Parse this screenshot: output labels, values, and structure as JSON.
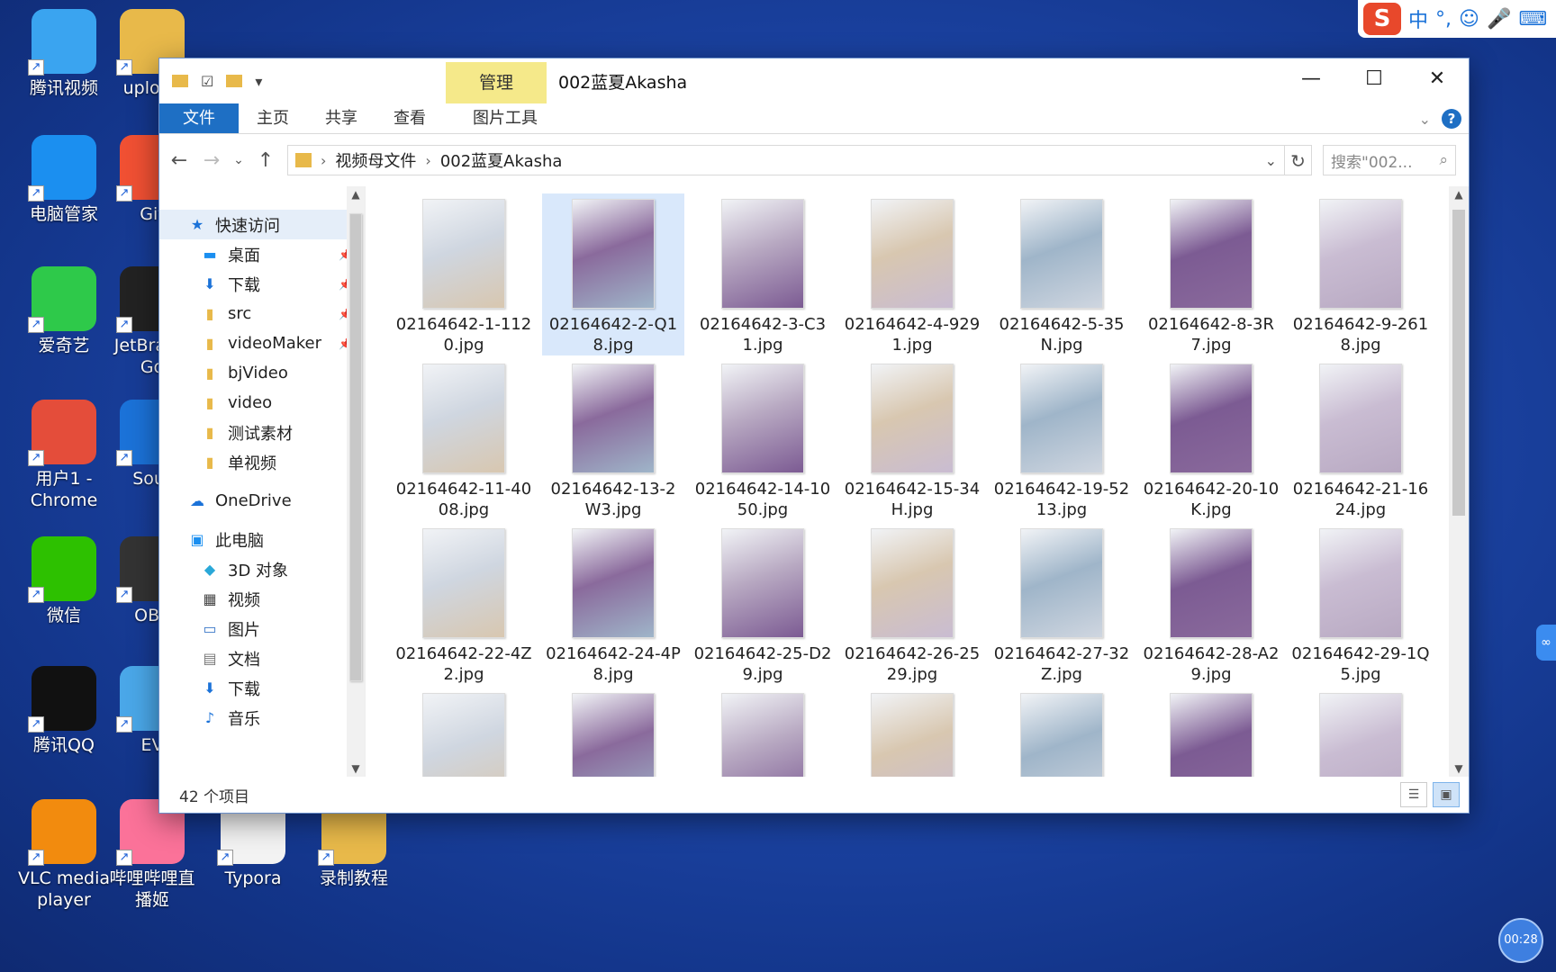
{
  "desktop_icons": [
    {
      "label": "腾讯视频",
      "color": "#3aa4f0"
    },
    {
      "label": "upload",
      "color": "#e8b94a"
    },
    {
      "label": "电脑管家",
      "color": "#1b8ff0"
    },
    {
      "label": "Git",
      "color": "#f05033"
    },
    {
      "label": "爱奇艺",
      "color": "#2ec94a"
    },
    {
      "label": "JetBrains Go",
      "color": "#222222"
    },
    {
      "label": "用户1 - Chrome",
      "color": "#e44d3a"
    },
    {
      "label": "Sour",
      "color": "#1b72d8"
    },
    {
      "label": "微信",
      "color": "#2dc100"
    },
    {
      "label": "OBS",
      "color": "#333333"
    },
    {
      "label": "腾讯QQ",
      "color": "#111111"
    },
    {
      "label": "EV",
      "color": "#4aa7e8"
    },
    {
      "label": "VLC media player",
      "color": "#f28b0e"
    },
    {
      "label": "哔哩哔哩直播姬",
      "color": "#fb7299"
    },
    {
      "label": "Typora",
      "color": "#f3f3f3"
    },
    {
      "label": "录制教程",
      "color": "#e8b94a"
    }
  ],
  "ime": {
    "logo": "S",
    "items": [
      "中",
      "°,",
      "☺",
      "🎤",
      "⌨"
    ]
  },
  "window": {
    "title": "002蓝夏Akasha",
    "manage_tab": "管理",
    "ribbon_tabs": [
      "文件",
      "主页",
      "共享",
      "查看",
      "图片工具"
    ],
    "controls": {
      "minimize": "—",
      "maximize": "☐",
      "close": "✕"
    },
    "breadcrumb": [
      "视频母文件",
      "002蓝夏Akasha"
    ],
    "search_placeholder": "搜索\"002...",
    "status": "42 个项目"
  },
  "nav_pane": [
    {
      "label": "快速访问",
      "icon": "star-icon",
      "glyph": "★",
      "color": "#1b72d8",
      "indent": 0,
      "pinned": false,
      "selected": true
    },
    {
      "label": "桌面",
      "icon": "desktop-icon",
      "glyph": "▬",
      "color": "#1b8ff0",
      "indent": 1,
      "pinned": true,
      "selected": false
    },
    {
      "label": "下载",
      "icon": "download-icon",
      "glyph": "⬇",
      "color": "#1b72d8",
      "indent": 1,
      "pinned": true,
      "selected": false
    },
    {
      "label": "src",
      "icon": "folder-icon",
      "glyph": "▮",
      "color": "#e8b94a",
      "indent": 1,
      "pinned": true,
      "selected": false
    },
    {
      "label": "videoMaker",
      "icon": "folder-icon",
      "glyph": "▮",
      "color": "#e8b94a",
      "indent": 1,
      "pinned": true,
      "selected": false
    },
    {
      "label": "bjVideo",
      "icon": "folder-icon",
      "glyph": "▮",
      "color": "#e8b94a",
      "indent": 1,
      "pinned": false,
      "selected": false
    },
    {
      "label": "video",
      "icon": "folder-icon",
      "glyph": "▮",
      "color": "#e8b94a",
      "indent": 1,
      "pinned": false,
      "selected": false
    },
    {
      "label": "测试素材",
      "icon": "folder-icon",
      "glyph": "▮",
      "color": "#e8b94a",
      "indent": 1,
      "pinned": false,
      "selected": false
    },
    {
      "label": "单视频",
      "icon": "folder-icon",
      "glyph": "▮",
      "color": "#e8b94a",
      "indent": 1,
      "pinned": false,
      "selected": false
    },
    {
      "label": "",
      "icon": "",
      "glyph": "",
      "color": "",
      "indent": 0,
      "pinned": false,
      "selected": false
    },
    {
      "label": "OneDrive",
      "icon": "cloud-icon",
      "glyph": "☁",
      "color": "#1b72d8",
      "indent": 0,
      "pinned": false,
      "selected": false
    },
    {
      "label": "",
      "icon": "",
      "glyph": "",
      "color": "",
      "indent": 0,
      "pinned": false,
      "selected": false
    },
    {
      "label": "此电脑",
      "icon": "computer-icon",
      "glyph": "▣",
      "color": "#1b8ff0",
      "indent": 0,
      "pinned": false,
      "selected": false
    },
    {
      "label": "3D 对象",
      "icon": "cube-icon",
      "glyph": "◆",
      "color": "#2aa8d8",
      "indent": 1,
      "pinned": false,
      "selected": false
    },
    {
      "label": "视频",
      "icon": "film-icon",
      "glyph": "▦",
      "color": "#444444",
      "indent": 1,
      "pinned": false,
      "selected": false
    },
    {
      "label": "图片",
      "icon": "picture-icon",
      "glyph": "▭",
      "color": "#3b78c8",
      "indent": 1,
      "pinned": false,
      "selected": false
    },
    {
      "label": "文档",
      "icon": "document-icon",
      "glyph": "▤",
      "color": "#777777",
      "indent": 1,
      "pinned": false,
      "selected": false
    },
    {
      "label": "下载",
      "icon": "download-icon",
      "glyph": "⬇",
      "color": "#1b72d8",
      "indent": 1,
      "pinned": false,
      "selected": false
    },
    {
      "label": "音乐",
      "icon": "music-icon",
      "glyph": "♪",
      "color": "#1b72d8",
      "indent": 1,
      "pinned": false,
      "selected": false
    }
  ],
  "files": [
    "02164642-1-1120.jpg",
    "02164642-2-Q18.jpg",
    "02164642-3-C31.jpg",
    "02164642-4-9291.jpg",
    "02164642-5-35N.jpg",
    "02164642-8-3R7.jpg",
    "02164642-9-2618.jpg",
    "02164642-11-4008.jpg",
    "02164642-13-2W3.jpg",
    "02164642-14-1050.jpg",
    "02164642-15-34H.jpg",
    "02164642-19-5213.jpg",
    "02164642-20-10K.jpg",
    "02164642-21-1624.jpg",
    "02164642-22-4Z2.jpg",
    "02164642-24-4P8.jpg",
    "02164642-25-D29.jpg",
    "02164642-26-2529.jpg",
    "02164642-27-32Z.jpg",
    "02164642-28-A29.jpg",
    "02164642-29-1Q5.jpg",
    "",
    "",
    "",
    "",
    "",
    "",
    ""
  ],
  "selected_file_index": 1,
  "recorder": {
    "time": "00:28"
  }
}
